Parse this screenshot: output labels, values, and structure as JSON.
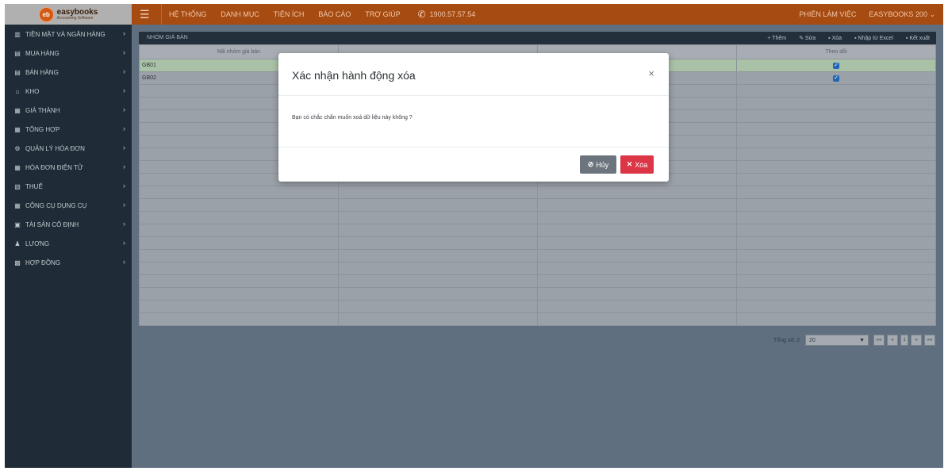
{
  "brand": {
    "name": "easybooks",
    "subtitle": "Accounting Software",
    "logo_glyph": "eb"
  },
  "topbar": {
    "menu": [
      "HỆ THỐNG",
      "DANH MỤC",
      "TIỆN ÍCH",
      "BÁO CÁO",
      "TRỢ GIÚP"
    ],
    "phone": "1900.57.57.54",
    "session": "PHIÊN LÀM VIỆC",
    "account": "EASYBOOKS 200 ⌄",
    "bg_color": "#a64b11"
  },
  "sidebar": {
    "items": [
      {
        "label": "TIỀN MẶT VÀ NGÂN HÀNG",
        "icon": "bank-icon"
      },
      {
        "label": "MUA HÀNG",
        "icon": "cart-icon"
      },
      {
        "label": "BÁN HÀNG",
        "icon": "cart-icon"
      },
      {
        "label": "KHO",
        "icon": "warehouse-icon"
      },
      {
        "label": "GIÁ THÀNH",
        "icon": "document-icon"
      },
      {
        "label": "TỔNG HỢP",
        "icon": "document-icon"
      },
      {
        "label": "QUẢN LÝ HÓA ĐƠN",
        "icon": "gear-icon"
      },
      {
        "label": "HÓA ĐƠN ĐIỆN TỬ",
        "icon": "document-icon"
      },
      {
        "label": "THUẾ",
        "icon": "tax-icon"
      },
      {
        "label": "CÔNG CỤ DỤNG CỤ",
        "icon": "document-icon"
      },
      {
        "label": "TÀI SẢN CỐ ĐỊNH",
        "icon": "asset-icon"
      },
      {
        "label": "LƯƠNG",
        "icon": "user-icon"
      },
      {
        "label": "HỢP ĐỒNG",
        "icon": "contract-icon"
      }
    ]
  },
  "toolbar": {
    "title": "NHÓM GIÁ BÁN",
    "add": "+ Thêm",
    "edit": "Sửa",
    "delete": "Xóa",
    "import": "Nhập từ Excel",
    "export": "Kết xuất"
  },
  "grid": {
    "columns": [
      "Mã nhóm giá bán",
      "",
      "",
      "Theo dõi"
    ],
    "rows": [
      {
        "code": "GB01",
        "tracked": true
      },
      {
        "code": "GB02",
        "tracked": true
      }
    ]
  },
  "pager": {
    "total_label": "Tổng số: 2",
    "page_size": "20",
    "first": "««",
    "prev": "«",
    "page": "1",
    "next": "»",
    "last": "»»"
  },
  "modal": {
    "title": "Xác nhận hành động xóa",
    "close": "×",
    "message": "Bạn có chắc chắn muốn xoá dữ liệu này không ?",
    "cancel_label": "Hủy",
    "delete_label": "Xóa",
    "cancel_color": "#6c757d",
    "delete_color": "#dc3545"
  }
}
